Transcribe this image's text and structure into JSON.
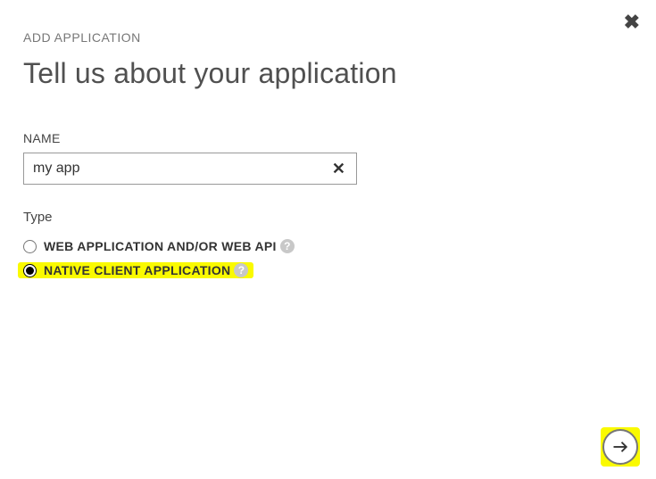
{
  "breadcrumb": "ADD APPLICATION",
  "title": "Tell us about your application",
  "name_field": {
    "label": "NAME",
    "value": "my app"
  },
  "type_section": {
    "label": "Type",
    "options": [
      {
        "label": "WEB APPLICATION AND/OR WEB API",
        "selected": false,
        "highlighted": false
      },
      {
        "label": "NATIVE CLIENT APPLICATION",
        "selected": true,
        "highlighted": true
      }
    ]
  }
}
